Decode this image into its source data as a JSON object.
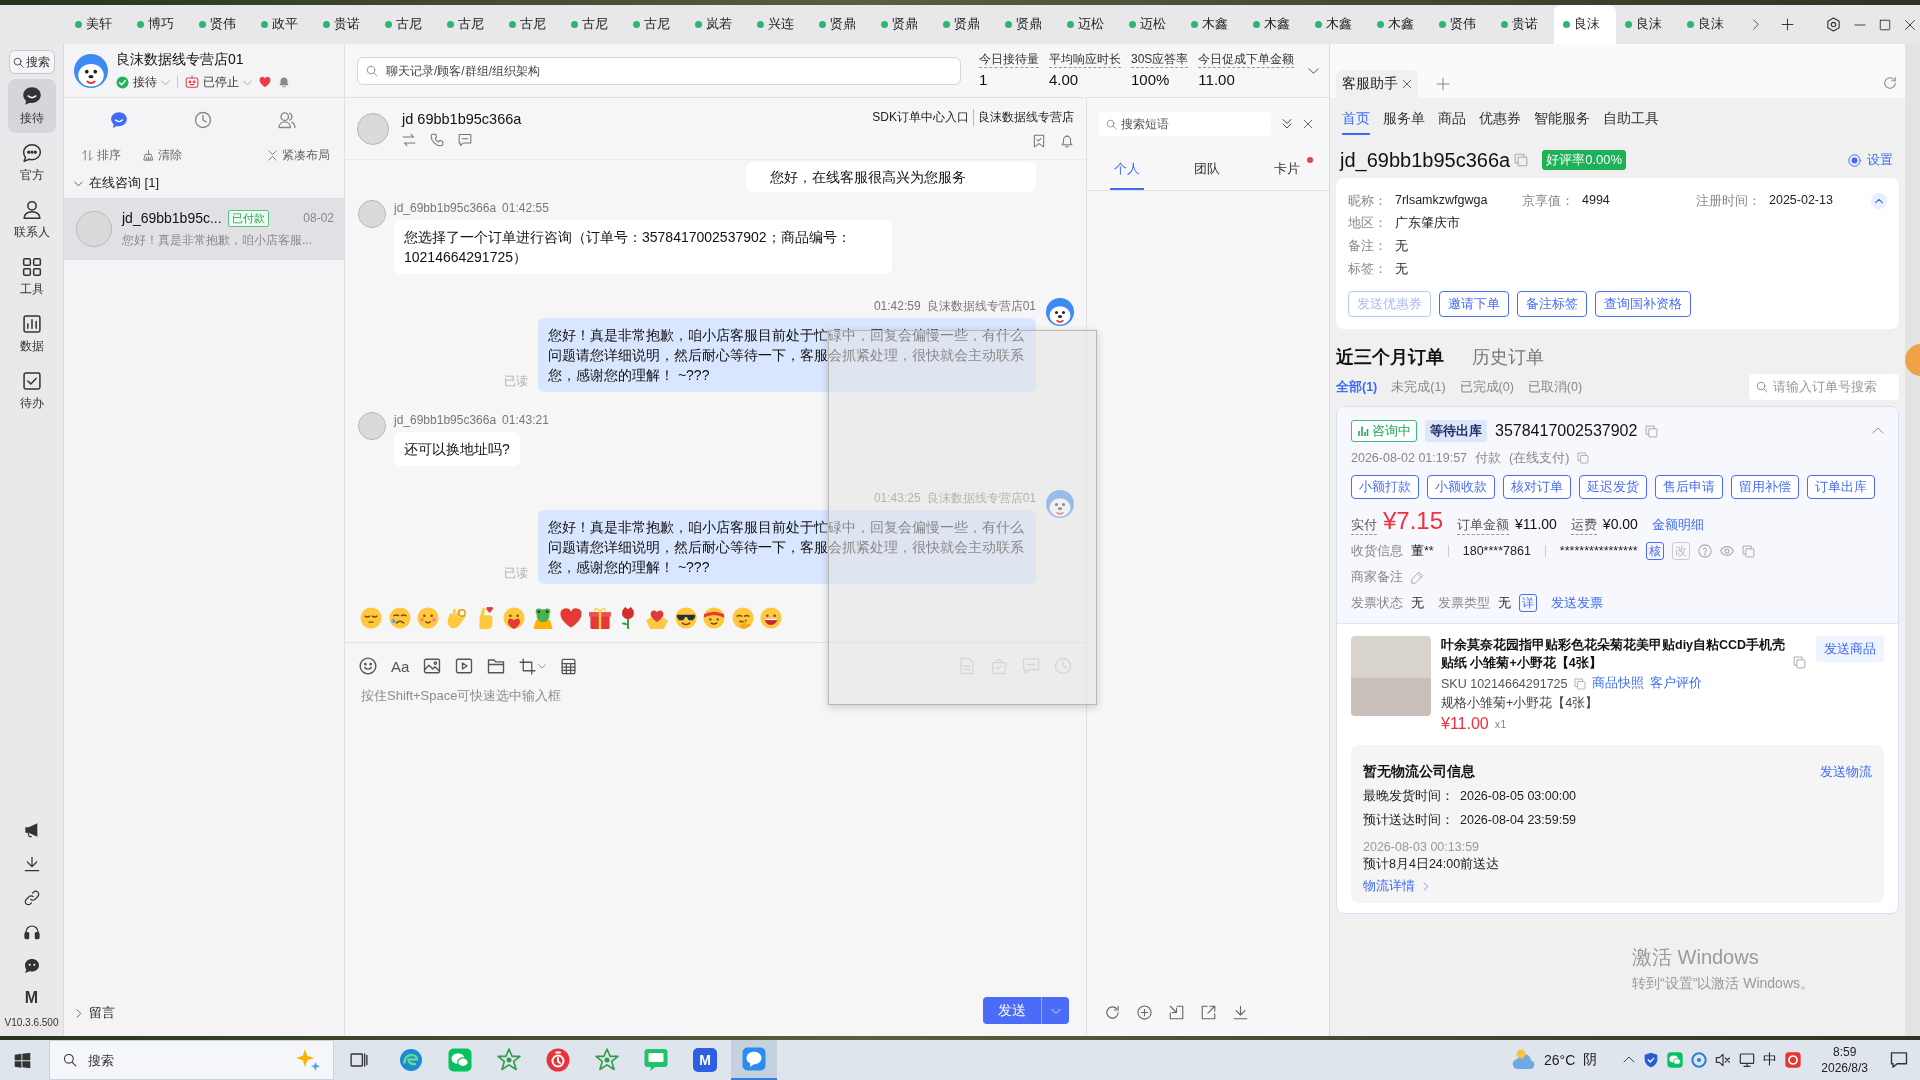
{
  "app_tabs": [
    {
      "label": "美轩",
      "selected": false
    },
    {
      "label": "博巧",
      "selected": false
    },
    {
      "label": "贤伟",
      "selected": false
    },
    {
      "label": "政平",
      "selected": false
    },
    {
      "label": "贵诺",
      "selected": false
    },
    {
      "label": "古尼",
      "selected": false
    },
    {
      "label": "古尼",
      "selected": false
    },
    {
      "label": "古尼",
      "selected": false
    },
    {
      "label": "古尼",
      "selected": false
    },
    {
      "label": "古尼",
      "selected": false
    },
    {
      "label": "岚若",
      "selected": false
    },
    {
      "label": "兴连",
      "selected": false
    },
    {
      "label": "贤鼎",
      "selected": false
    },
    {
      "label": "贤鼎",
      "selected": false
    },
    {
      "label": "贤鼎",
      "selected": false
    },
    {
      "label": "贤鼎",
      "selected": false
    },
    {
      "label": "迈松",
      "selected": false
    },
    {
      "label": "迈松",
      "selected": false
    },
    {
      "label": "木鑫",
      "selected": false
    },
    {
      "label": "木鑫",
      "selected": false
    },
    {
      "label": "木鑫",
      "selected": false
    },
    {
      "label": "木鑫",
      "selected": false
    },
    {
      "label": "贤伟",
      "selected": false
    },
    {
      "label": "贵诺",
      "selected": false
    },
    {
      "label": "良沫",
      "selected": true
    },
    {
      "label": "良沫",
      "selected": false
    },
    {
      "label": "良沫",
      "selected": false
    }
  ],
  "nav": {
    "search": "搜索",
    "items": [
      {
        "label": "接待",
        "selected": true
      },
      {
        "label": "官方",
        "selected": false
      },
      {
        "label": "联系人",
        "selected": false
      },
      {
        "label": "工具",
        "selected": false
      },
      {
        "label": "数据",
        "selected": false
      },
      {
        "label": "待办",
        "selected": false
      }
    ],
    "shortcut_label": "M",
    "version": "V10.3.6.500"
  },
  "store": {
    "name": "良沫数据线专营店01",
    "reception": "接待",
    "auto_reply": "已停止"
  },
  "conversation_tabs": [
    {
      "selected": true
    },
    {
      "selected": false
    },
    {
      "selected": false
    }
  ],
  "list_actions": [
    "排序",
    "清除",
    "紧凑布局"
  ],
  "online_group": {
    "label": "在线咨询 [1]",
    "expanded": true,
    "conversations": [
      {
        "name": "jd_69bb1b95c...",
        "badge": "已付款",
        "date": "08-02",
        "preview": "您好！真是非常抱歉，咱小店客服...",
        "selected": true
      }
    ]
  },
  "message_group": {
    "label": "留言",
    "expanded": false
  },
  "search": {
    "placeholder": "聊天记录/顾客/群组/组织架构"
  },
  "stats": [
    {
      "label": "今日接待量",
      "value": "1"
    },
    {
      "label": "平均响应时长",
      "value": "4.00"
    },
    {
      "label": "30S应答率",
      "value": "100%"
    },
    {
      "label": "今日促成下单金额",
      "value": "11.00"
    }
  ],
  "chat": {
    "title": "jd 69bb1b95c366a",
    "links": [
      "SDK订单中心入口",
      "良沫数据线专营店"
    ],
    "messages": [
      {
        "kind": "auto_reply",
        "text": "您好，在线客服很高兴为您服务"
      },
      {
        "kind": "customer",
        "sender": "jd_69bb1b95c366a",
        "time": "01:42:55",
        "text": "您选择了一个订单进行咨询（订单号：3578417002537902；商品编号：10214664291725）"
      },
      {
        "kind": "agent",
        "sender": "良沫数据线专营店01",
        "time": "01:42:59",
        "text": "您好！真是非常抱歉，咱小店客服目前处于忙碌中，回复会偏慢一些，有什么问题请您详细说明，然后耐心等待一下，客服会抓紧处理，很快就会主动联系您，感谢您的理解！ ~???",
        "read": "已读"
      },
      {
        "kind": "customer",
        "sender": "jd_69bb1b95c366a",
        "time": "01:43:21",
        "text": "还可以换地址吗?"
      },
      {
        "kind": "agent",
        "sender": "良沫数据线专营店01",
        "time": "01:43:25",
        "text": "您好！真是非常抱歉，咱小店客服目前处于忙碌中，回复会偏慢一些，有什么问题请您详细说明，然后耐心等待一下，客服会抓紧处理，很快就会主动联系您，感谢您的理解！ ~???",
        "read": "已读"
      }
    ],
    "font_label": "Aa",
    "input_placeholder": "按住Shift+Space可快速选中输入框",
    "send": "发送"
  },
  "quick_replies": {
    "search_placeholder": "搜索短语",
    "tabs": [
      {
        "label": "个人",
        "selected": true,
        "alert": false
      },
      {
        "label": "团队",
        "selected": false,
        "alert": false
      },
      {
        "label": "卡片",
        "selected": false,
        "alert": true
      }
    ]
  },
  "assistant": {
    "tab": "客服助手",
    "nav": [
      {
        "label": "首页",
        "selected": true
      },
      {
        "label": "服务单",
        "selected": false
      },
      {
        "label": "商品",
        "selected": false
      },
      {
        "label": "优惠券",
        "selected": false
      },
      {
        "label": "智能服务",
        "selected": false
      },
      {
        "label": "自助工具",
        "selected": false
      }
    ],
    "customer_id": "jd_69bb1b95c366a",
    "rating": "好评率0.00%",
    "settings": {
      "label": "设置",
      "on": true
    },
    "profile": {
      "expanded": true,
      "fields": [
        {
          "label": "昵称：",
          "value": "7rlsamkzwfgwga"
        },
        {
          "label": "京享值：",
          "value": "4994"
        },
        {
          "label": "注册时间：",
          "value": "2025-02-13"
        },
        {
          "label": "地区：",
          "value": "广东肇庆市"
        },
        {
          "label": "备注：",
          "value": "无"
        },
        {
          "label": "标签：",
          "value": "无"
        }
      ],
      "actions": [
        {
          "label": "发送优惠券",
          "disabled": true
        },
        {
          "label": "邀请下单",
          "disabled": false
        },
        {
          "label": "备注标签",
          "disabled": false
        },
        {
          "label": "查询国补资格",
          "disabled": false
        }
      ]
    },
    "order_tabs": [
      {
        "label": "近三个月订单",
        "selected": true
      },
      {
        "label": "历史订单",
        "selected": false
      }
    ],
    "filters": [
      {
        "label": "全部(1)",
        "selected": true
      },
      {
        "label": "未完成(1)",
        "selected": false
      },
      {
        "label": "已完成(0)",
        "selected": false
      },
      {
        "label": "已取消(0)",
        "selected": false
      }
    ],
    "order_search_placeholder": "请输入订单号搜索",
    "order": {
      "expanded": true,
      "consult_tag": "咨询中",
      "status_tag": "等待出库",
      "number": "3578417002537902",
      "paid_time": "2026-08-02 01:19:57",
      "paid_label": "付款",
      "pay_method": "(在线支付)",
      "actions": [
        "小额打款",
        "小额收款",
        "核对订单",
        "延迟发货",
        "售后申请",
        "留用补偿",
        "订单出库"
      ],
      "amounts": [
        {
          "kind": "paid",
          "label": "实付",
          "value": "¥7.15"
        },
        {
          "kind": "plain",
          "label": "订单金额",
          "value": "¥11.00"
        },
        {
          "kind": "plain",
          "label": "运费",
          "value": "¥0.00"
        }
      ],
      "amount_detail": "金额明细",
      "receiver": {
        "label": "收货信息",
        "name": "董**",
        "phone": "180****7861",
        "address": "****************",
        "actions": [
          {
            "label": "核",
            "disabled": false
          },
          {
            "label": "改",
            "disabled": true
          }
        ]
      },
      "merchant_note": "商家备注",
      "invoice": {
        "status_label": "发票状态",
        "status": "无",
        "type_label": "发票类型",
        "type": "无",
        "detail": "详",
        "send": "发送发票"
      },
      "product": {
        "title": "叶余莫奈花园指甲贴彩色花朵菊花美甲贴diy自粘CCD手机壳贴纸 小雏菊+小野花【4张】",
        "send": "发送商品",
        "sku": "SKU 10214664291725",
        "links": [
          "商品快照",
          "客户评价"
        ],
        "spec": "规格小雏菊+小野花【4张】",
        "price": "¥11.00",
        "quantity": "x1"
      },
      "logistics": {
        "title": "暂无物流公司信息",
        "send": "发送物流",
        "rows": [
          {
            "label": "最晚发货时间：",
            "value": "2026-08-05 03:00:00"
          },
          {
            "label": "预计送达时间：",
            "value": "2026-08-04 23:59:59"
          }
        ],
        "update_time": "2026-08-03 00:13:59",
        "update_text": "预计8月4日24:00前送达",
        "detail_link": "物流详情"
      }
    }
  },
  "activation_notice": {
    "title": "激活 Windows",
    "text": "转到“设置”以激活 Windows。"
  },
  "taskbar": {
    "search_placeholder": "搜索",
    "app_label": "M",
    "temperature": "26°C",
    "weather": "阴",
    "input_method": "中",
    "time": "8:59",
    "date": "2026/8/3"
  }
}
